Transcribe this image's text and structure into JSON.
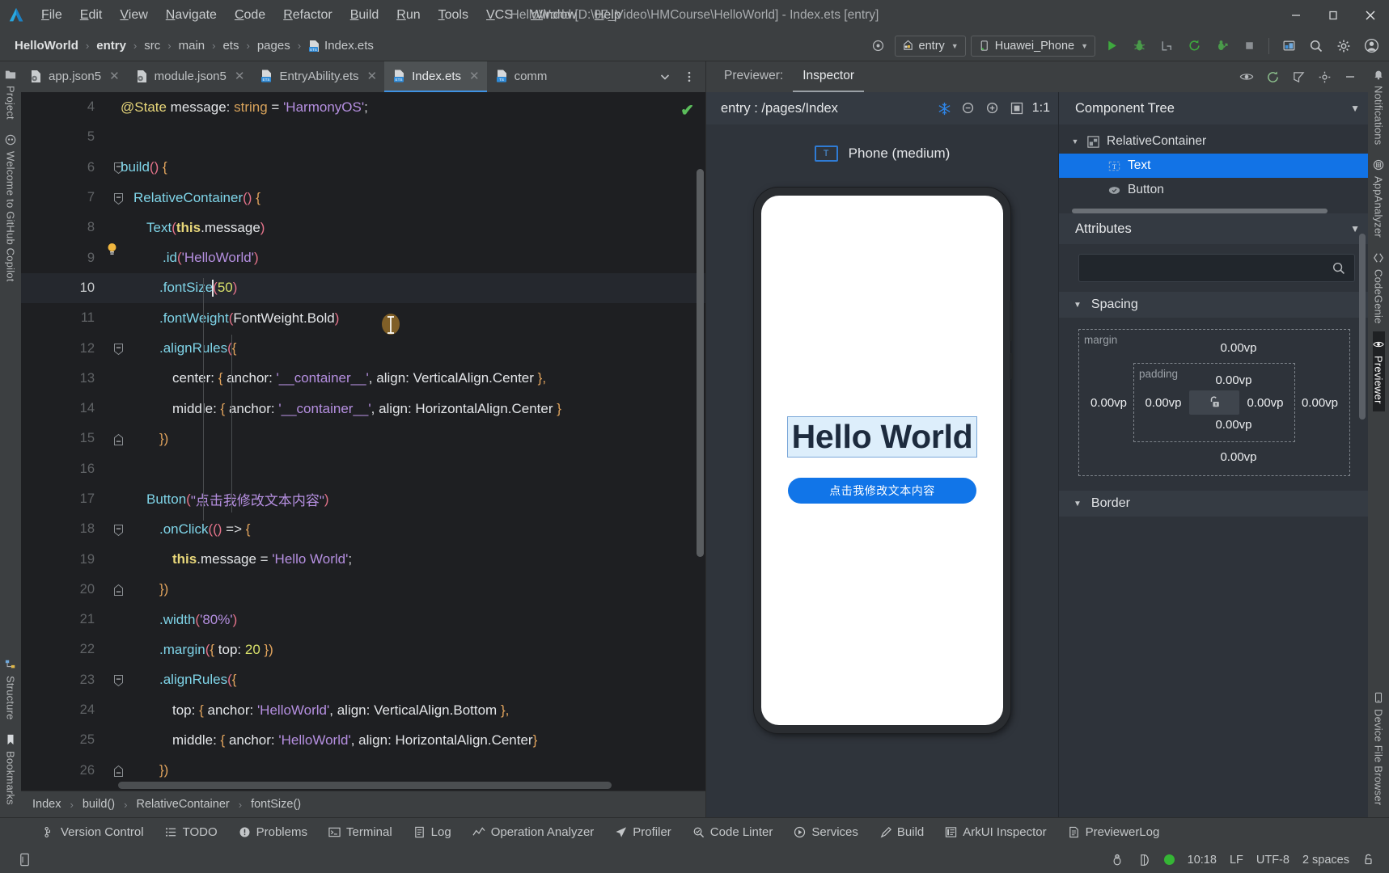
{
  "window": {
    "title": "HelloWorld [D:\\07_Video\\HMCourse\\HelloWorld] - Index.ets [entry]",
    "minimize_label": "–",
    "restore_label": "❐",
    "close_label": "✕"
  },
  "menubar": [
    "File",
    "Edit",
    "View",
    "Navigate",
    "Code",
    "Refactor",
    "Build",
    "Run",
    "Tools",
    "VCS",
    "Window",
    "Help"
  ],
  "breadcrumbs": [
    "HelloWorld",
    "entry",
    "src",
    "main",
    "ets",
    "pages",
    "Index.ets"
  ],
  "toolbar": {
    "module_selector": "entry",
    "device_selector": "Huawei_Phone",
    "run_icon": "run-icon",
    "debug_icon": "debug-icon",
    "profile_icon": "profile-icon",
    "rerun_icon": "rerun-icon",
    "attach_icon": "attach-debugger-icon",
    "stop_icon": "stop-icon",
    "device_manager_icon": "device-manager-icon",
    "search_icon": "search-everywhere-icon",
    "settings_icon": "settings-icon",
    "account_icon": "account-icon",
    "target_icon": "target-icon"
  },
  "editor_tabs": [
    {
      "label": "app.json5",
      "icon": "json5-file-icon",
      "active": false
    },
    {
      "label": "module.json5",
      "icon": "json5-file-icon",
      "active": false
    },
    {
      "label": "EntryAbility.ets",
      "icon": "ets-file-icon",
      "active": false
    },
    {
      "label": "Index.ets",
      "icon": "ets-file-icon",
      "active": true
    },
    {
      "label": "comm",
      "icon": "ts-file-icon",
      "active": false
    }
  ],
  "code": {
    "first_line_number": 4,
    "current_line": 10,
    "lines": [
      {
        "n": 4,
        "indent": 1,
        "tokens": [
          [
            "t-dec",
            "@State"
          ],
          [
            "t-txt",
            " message"
          ],
          [
            "t-op",
            ": "
          ],
          [
            "t-type",
            "string"
          ],
          [
            "t-op",
            " = "
          ],
          [
            "t-str",
            "'HarmonyOS'"
          ],
          [
            "t-op",
            ";"
          ]
        ]
      },
      {
        "n": 5,
        "indent": 0,
        "tokens": []
      },
      {
        "n": 6,
        "indent": 1,
        "fold": "minus",
        "tokens": [
          [
            "t-fn",
            "build"
          ],
          [
            "t-par",
            "()"
          ],
          [
            "t-br",
            " {"
          ]
        ]
      },
      {
        "n": 7,
        "indent": 2,
        "fold": "minus",
        "tokens": [
          [
            "t-fn",
            "RelativeContainer"
          ],
          [
            "t-par",
            "()"
          ],
          [
            "t-br",
            " {"
          ]
        ]
      },
      {
        "n": 8,
        "indent": 3,
        "tokens": [
          [
            "t-fn",
            "Text"
          ],
          [
            "t-par",
            "("
          ],
          [
            "t-kw",
            "this"
          ],
          [
            "t-txt",
            ".message"
          ],
          [
            "t-par",
            ")"
          ]
        ]
      },
      {
        "n": 9,
        "indent": 4,
        "bulb": true,
        "tokens": [
          [
            "t-fn",
            ".id"
          ],
          [
            "t-par",
            "("
          ],
          [
            "t-str",
            "'HelloWorld'"
          ],
          [
            "t-par",
            ")"
          ]
        ]
      },
      {
        "n": 10,
        "indent": 4,
        "caret_after": 1,
        "tokens": [
          [
            "t-fn",
            ".fontSize"
          ],
          [
            "t-par",
            "("
          ],
          [
            "t-num",
            "50"
          ],
          [
            "t-par",
            ")"
          ]
        ]
      },
      {
        "n": 11,
        "indent": 4,
        "tokens": [
          [
            "t-fn",
            ".fontWeight"
          ],
          [
            "t-par",
            "("
          ],
          [
            "t-txt",
            "FontWeight.Bold"
          ],
          [
            "t-par",
            ")"
          ]
        ]
      },
      {
        "n": 12,
        "indent": 4,
        "fold": "minus",
        "tokens": [
          [
            "t-fn",
            ".alignRules"
          ],
          [
            "t-par",
            "("
          ],
          [
            "t-br",
            "{"
          ]
        ]
      },
      {
        "n": 13,
        "indent": 5,
        "tokens": [
          [
            "t-txt",
            "center: "
          ],
          [
            "t-br",
            "{"
          ],
          [
            "t-txt",
            " anchor: "
          ],
          [
            "t-str",
            "'__container__'"
          ],
          [
            "t-txt",
            ", align: VerticalAlign.Center "
          ],
          [
            "t-br",
            "},"
          ]
        ]
      },
      {
        "n": 14,
        "indent": 5,
        "tokens": [
          [
            "t-txt",
            "middle: "
          ],
          [
            "t-br",
            "{"
          ],
          [
            "t-txt",
            " anchor: "
          ],
          [
            "t-str",
            "'__container__'"
          ],
          [
            "t-txt",
            ", align: HorizontalAlign.Center "
          ],
          [
            "t-br",
            "}"
          ]
        ]
      },
      {
        "n": 15,
        "indent": 4,
        "fold": "plus",
        "tokens": [
          [
            "t-br",
            "})"
          ]
        ]
      },
      {
        "n": 16,
        "indent": 0,
        "tokens": []
      },
      {
        "n": 17,
        "indent": 3,
        "tokens": [
          [
            "t-fn",
            "Button"
          ],
          [
            "t-par",
            "("
          ],
          [
            "t-str",
            "\"点击我修改文本内容\""
          ],
          [
            "t-par",
            ")"
          ]
        ]
      },
      {
        "n": 18,
        "indent": 4,
        "fold": "minus",
        "tokens": [
          [
            "t-fn",
            ".onClick"
          ],
          [
            "t-par",
            "(()"
          ],
          [
            "t-op",
            " => "
          ],
          [
            "t-br",
            "{"
          ]
        ]
      },
      {
        "n": 19,
        "indent": 5,
        "tokens": [
          [
            "t-kw",
            "this"
          ],
          [
            "t-txt",
            ".message"
          ],
          [
            "t-op",
            " = "
          ],
          [
            "t-str",
            "'Hello World'"
          ],
          [
            "t-op",
            ";"
          ]
        ]
      },
      {
        "n": 20,
        "indent": 4,
        "fold": "plus",
        "tokens": [
          [
            "t-br",
            "})"
          ]
        ]
      },
      {
        "n": 21,
        "indent": 4,
        "tokens": [
          [
            "t-fn",
            ".width"
          ],
          [
            "t-par",
            "("
          ],
          [
            "t-str",
            "'80%'"
          ],
          [
            "t-par",
            ")"
          ]
        ]
      },
      {
        "n": 22,
        "indent": 4,
        "tokens": [
          [
            "t-fn",
            ".margin"
          ],
          [
            "t-par",
            "("
          ],
          [
            "t-br",
            "{"
          ],
          [
            "t-txt",
            " top: "
          ],
          [
            "t-num",
            "20"
          ],
          [
            "t-br",
            " })"
          ]
        ]
      },
      {
        "n": 23,
        "indent": 4,
        "fold": "minus",
        "tokens": [
          [
            "t-fn",
            ".alignRules"
          ],
          [
            "t-par",
            "("
          ],
          [
            "t-br",
            "{"
          ]
        ]
      },
      {
        "n": 24,
        "indent": 5,
        "tokens": [
          [
            "t-txt",
            "top: "
          ],
          [
            "t-br",
            "{"
          ],
          [
            "t-txt",
            " anchor: "
          ],
          [
            "t-str",
            "'HelloWorld'"
          ],
          [
            "t-txt",
            ", align: VerticalAlign.Bottom "
          ],
          [
            "t-br",
            "},"
          ]
        ]
      },
      {
        "n": 25,
        "indent": 5,
        "tokens": [
          [
            "t-txt",
            "middle: "
          ],
          [
            "t-br",
            "{"
          ],
          [
            "t-txt",
            " anchor: "
          ],
          [
            "t-str",
            "'HelloWorld'"
          ],
          [
            "t-txt",
            ", align: HorizontalAlign.Center"
          ],
          [
            "t-br",
            "}"
          ]
        ]
      },
      {
        "n": 26,
        "indent": 4,
        "fold": "plus",
        "tokens": [
          [
            "t-br",
            "})"
          ]
        ]
      },
      {
        "n": 27,
        "indent": 0,
        "tokens": []
      }
    ]
  },
  "editor_breadcrumb": [
    "Index",
    "build()",
    "RelativeContainer",
    "fontSize()"
  ],
  "previewer": {
    "tabs": [
      {
        "label": "Previewer:",
        "active": false
      },
      {
        "label": "Inspector",
        "active": true
      }
    ],
    "path": "entry : /pages/Index",
    "zoom_label": "1:1",
    "icons": {
      "freeze": "snowflake-icon",
      "zoom_out": "zoom-out-icon",
      "zoom_in": "zoom-in-icon",
      "fit": "fit-screen-icon"
    },
    "device": {
      "badge": "T",
      "label": "Phone (medium)"
    },
    "screen": {
      "text": "Hello World",
      "button": "点击我修改文本内容"
    }
  },
  "inspector": {
    "component_tree_title": "Component Tree",
    "tree": [
      {
        "label": "RelativeContainer",
        "icon": "relative-container-icon",
        "depth": 0,
        "selected": false,
        "expandable": true
      },
      {
        "label": "Text",
        "icon": "text-component-icon",
        "depth": 1,
        "selected": true,
        "expandable": false
      },
      {
        "label": "Button",
        "icon": "button-component-icon",
        "depth": 1,
        "selected": false,
        "expandable": false
      }
    ],
    "attributes_title": "Attributes",
    "search_placeholder": "",
    "search_value": "",
    "groups": [
      {
        "label": "Spacing",
        "expanded": true
      },
      {
        "label": "Border",
        "expanded": true
      }
    ],
    "spacing": {
      "margin_label": "margin",
      "padding_label": "padding",
      "margin_top": "0.00vp",
      "margin_right": "0.00vp",
      "margin_bottom": "0.00vp",
      "margin_left": "0.00vp",
      "padding_top": "0.00vp",
      "padding_right": "0.00vp",
      "padding_bottom": "0.00vp",
      "padding_left": "0.00vp",
      "lock_icon": "lock-open-icon"
    }
  },
  "left_rail": [
    {
      "label": "Project",
      "icon": "project-icon"
    },
    {
      "label": "Welcome to GitHub Copilot",
      "icon": "copilot-icon"
    },
    {
      "label": "Structure",
      "icon": "structure-icon"
    },
    {
      "label": "Bookmarks",
      "icon": "bookmarks-icon"
    }
  ],
  "right_rail": [
    {
      "label": "Notifications",
      "icon": "bell-icon",
      "active": false
    },
    {
      "label": "AppAnalyzer",
      "icon": "app-analyzer-icon",
      "active": false
    },
    {
      "label": "CodeGenie",
      "icon": "code-genie-icon",
      "active": false
    },
    {
      "label": "Previewer",
      "icon": "eye-icon",
      "active": true
    },
    {
      "label": "Device File Browser",
      "icon": "device-file-browser-icon",
      "active": false
    }
  ],
  "tool_window_bar": [
    {
      "label": "Version Control",
      "icon": "branch-icon"
    },
    {
      "label": "TODO",
      "icon": "todo-icon"
    },
    {
      "label": "Problems",
      "icon": "problems-icon"
    },
    {
      "label": "Terminal",
      "icon": "terminal-icon"
    },
    {
      "label": "Log",
      "icon": "log-icon"
    },
    {
      "label": "Operation Analyzer",
      "icon": "operation-analyzer-icon"
    },
    {
      "label": "Profiler",
      "icon": "profiler-icon"
    },
    {
      "label": "Code Linter",
      "icon": "code-linter-icon"
    },
    {
      "label": "Services",
      "icon": "services-icon"
    },
    {
      "label": "Build",
      "icon": "build-icon"
    },
    {
      "label": "ArkUI Inspector",
      "icon": "arkui-inspector-icon"
    },
    {
      "label": "PreviewerLog",
      "icon": "previewer-log-icon"
    }
  ],
  "statusbar": {
    "left_icon": "memory-indicator-icon",
    "items": [
      "10:18",
      "LF",
      "UTF-8",
      "2 spaces"
    ],
    "icons": [
      "bug-status-icon",
      "battery-icon",
      "status-ok-dot",
      "lock-icon"
    ]
  },
  "colors": {
    "accent": "#1273e6",
    "editor_bg": "#1e1f22",
    "chrome_bg": "#3c3f41",
    "panel_bg": "#2e333a",
    "ok_green": "#35b535"
  }
}
